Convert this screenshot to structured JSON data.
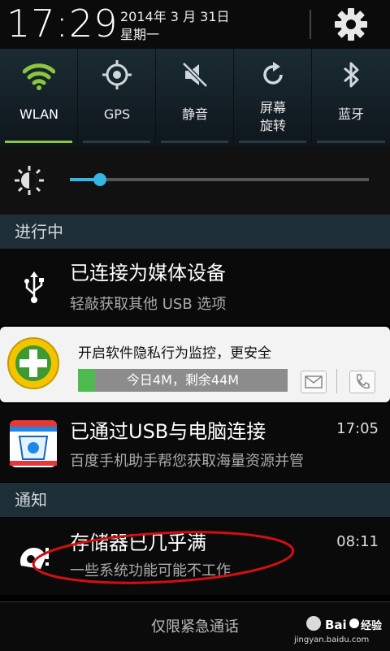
{
  "status_bar": {
    "time": "17:29",
    "date": "2014年 3 月 31日",
    "weekday": "星期一"
  },
  "toggles": [
    {
      "label": "WLAN",
      "icon": "wifi-icon",
      "on": true
    },
    {
      "label": "GPS",
      "icon": "gps-icon",
      "on": false
    },
    {
      "label": "静音",
      "icon": "mute-icon",
      "on": false
    },
    {
      "label_line1": "屏幕",
      "label_line2": "旋转",
      "icon": "rotate-icon",
      "on": false
    },
    {
      "label": "蓝牙",
      "icon": "bluetooth-icon",
      "on": false
    }
  ],
  "brightness": {
    "level_percent": 10
  },
  "sections": {
    "ongoing": "进行中",
    "notifications": "通知"
  },
  "usb_notification": {
    "title": "已连接为媒体设备",
    "subtitle": "轻敲获取其他 USB 选项"
  },
  "security_card": {
    "title": "开启软件隐私行为监控，更安全",
    "progress_text": "今日4M，剩余44M",
    "progress_percent": 8
  },
  "baidu_notification": {
    "title": "已通过USB与电脑连接",
    "subtitle": "百度手机助手帮您获取海量资源并管",
    "time": "17:05"
  },
  "storage_notification": {
    "title": "存储器已几乎满",
    "subtitle": "一些系统功能可能不工作",
    "time": "08:11"
  },
  "bottom_bar": {
    "emergency_text": "仅限紧急通话",
    "watermark_url": "jingyan.baidu.com"
  },
  "colors": {
    "accent": "#33b5e5",
    "toggle_on": "#8cc63f",
    "annotation": "#d01010"
  }
}
